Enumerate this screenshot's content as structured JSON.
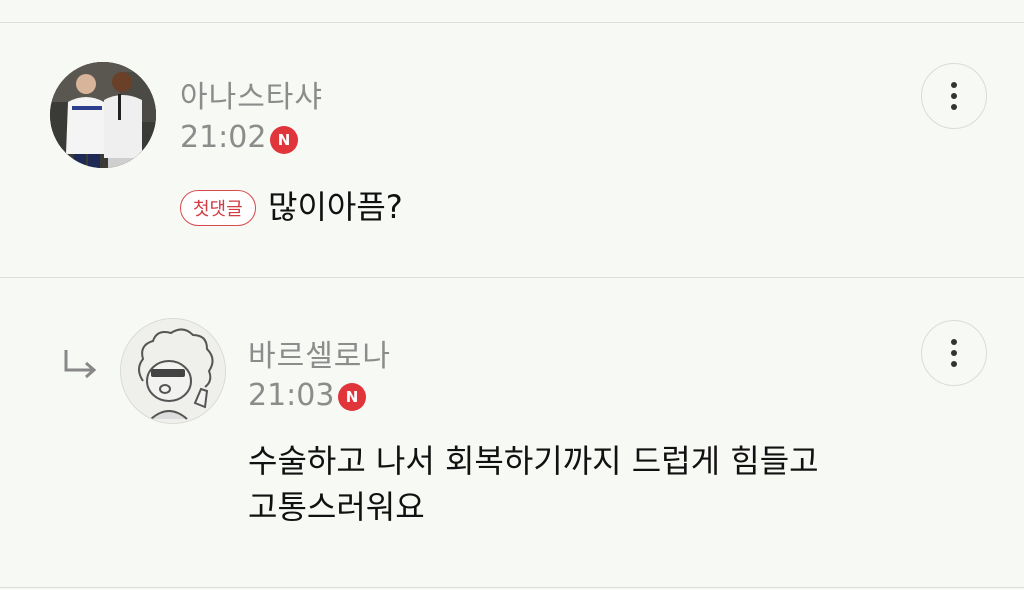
{
  "comments": [
    {
      "username": "아나스타샤",
      "time": "21:02",
      "badge": "N",
      "tag": "첫댓글",
      "text": "많이아픔?"
    },
    {
      "username": "바르셀로나",
      "time": "21:03",
      "badge": "N",
      "text": "수술하고 나서 회복하기까지 드럽게 힘들고\n고통스러워요"
    }
  ]
}
